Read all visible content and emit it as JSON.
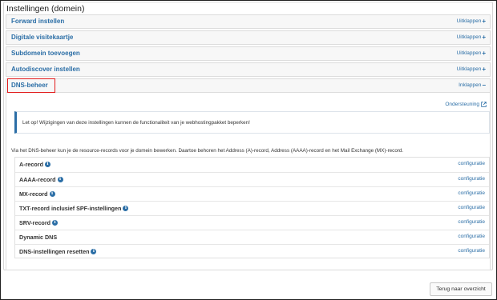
{
  "panel": {
    "title": "Instellingen (domein)"
  },
  "sections": [
    {
      "label": "Forward instellen",
      "toggle": "Uitklappen",
      "symbol": "+"
    },
    {
      "label": "Digitale visitekaartje",
      "toggle": "Uitklappen",
      "symbol": "+"
    },
    {
      "label": "Subdomein toevoegen",
      "toggle": "Uitklappen",
      "symbol": "+"
    },
    {
      "label": "Autodiscover instellen",
      "toggle": "Uitklappen",
      "symbol": "+"
    },
    {
      "label": "DNS-beheer",
      "toggle": "Inklappen",
      "symbol": "−"
    }
  ],
  "dns": {
    "support_link": "Ondersteuning",
    "alert": "Let op! Wijzigingen van deze instellingen kunnen de functionaliteit van je webhostingpakket beperken!",
    "intro": "Via het DNS-beheer kun je de resource-records voor je domein bewerken. Daartoe behoren het Address (A)-record, Address (AAAA)-record en het Mail Exchange (MX)-record.",
    "records": [
      {
        "label": "A-record",
        "link": "configuratie"
      },
      {
        "label": "AAAA-record",
        "link": "configuratie"
      },
      {
        "label": "MX-record",
        "link": "configuratie"
      },
      {
        "label": "TXT-record inclusief SPF-instellingen",
        "link": "configuratie"
      },
      {
        "label": "SRV-record",
        "link": "configuratie"
      },
      {
        "label": "Dynamic DNS",
        "link": "configuratie"
      },
      {
        "label": "DNS-instellingen resetten",
        "link": "configuratie"
      }
    ],
    "info_glyph": "i"
  },
  "footer": {
    "back_label": "Terug naar overzicht"
  },
  "colors": {
    "link": "#2b6ea6",
    "highlight": "#e21b1b",
    "border": "#d4d4d4"
  }
}
